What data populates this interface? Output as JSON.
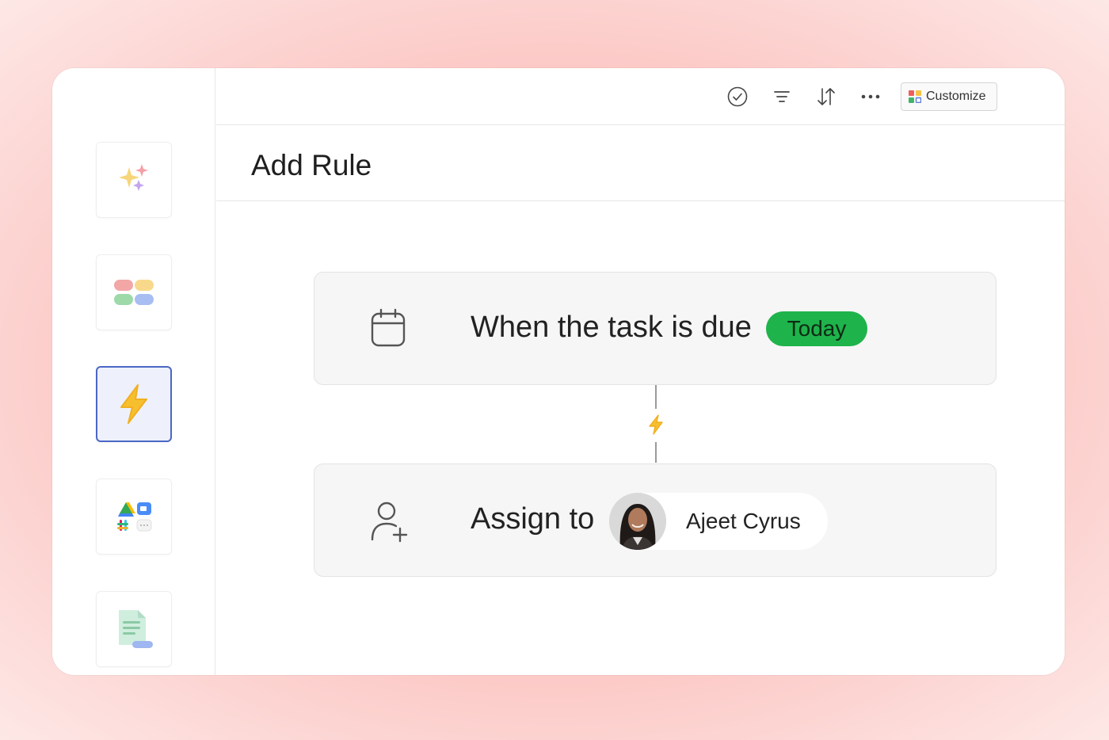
{
  "toolbar": {
    "icons": [
      "check-circle-icon",
      "filter-icon",
      "sort-icon",
      "more-icon"
    ],
    "customize_label": "Customize"
  },
  "page": {
    "title": "Add Rule"
  },
  "sidebar": {
    "tiles": [
      {
        "icon": "sparkles-icon",
        "active": false
      },
      {
        "icon": "tags-icon",
        "active": false
      },
      {
        "icon": "bolt-icon",
        "active": true
      },
      {
        "icon": "integrations-icon",
        "active": false
      },
      {
        "icon": "document-icon",
        "active": false
      }
    ]
  },
  "rule": {
    "trigger": {
      "icon": "calendar-icon",
      "text": "When the task is due",
      "badge": "Today",
      "badge_color": "#1fb34b"
    },
    "connector_icon": "bolt-icon",
    "action": {
      "icon": "add-user-icon",
      "text": "Assign to",
      "assignee": "Ajeet Cyrus"
    }
  }
}
